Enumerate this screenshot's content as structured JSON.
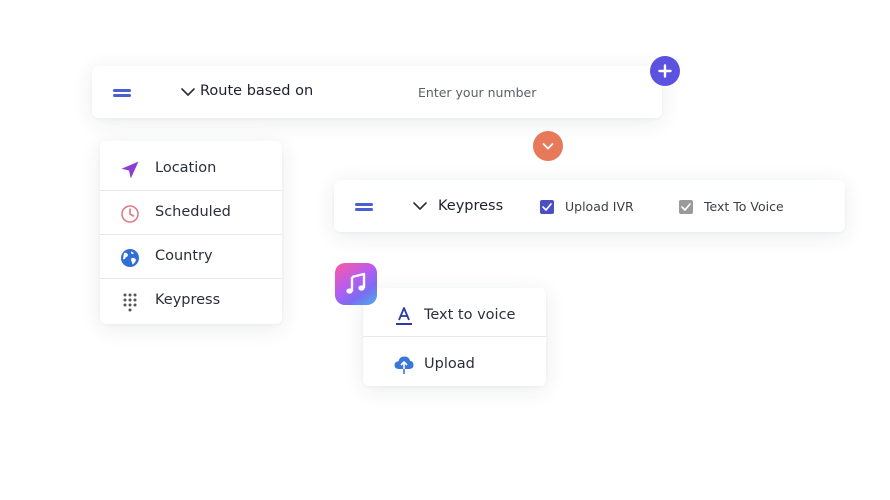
{
  "route_bar": {
    "label": "Route based on",
    "input_placeholder": "Enter your number"
  },
  "route_options": [
    {
      "label": "Location",
      "icon": "location-arrow-icon",
      "color": "#8a3fd1"
    },
    {
      "label": "Scheduled",
      "icon": "clock-icon",
      "color": "#e07a86"
    },
    {
      "label": "Country",
      "icon": "globe-icon",
      "color": "#2f6fd6"
    },
    {
      "label": "Keypress",
      "icon": "dialpad-icon",
      "color": "#555555"
    }
  ],
  "keypress_bar": {
    "label": "Keypress",
    "upload_ivr": {
      "label": "Upload IVR",
      "checked": true,
      "color": "#4a4fc4"
    },
    "text_to_voice": {
      "label": "Text To Voice",
      "checked": true,
      "color": "#9a9a9a"
    }
  },
  "voice_menu": [
    {
      "label": "Text to voice",
      "icon": "text-format-icon",
      "color": "#2a3aa0"
    },
    {
      "label": "Upload",
      "icon": "cloud-upload-icon",
      "color": "#3a78d8"
    }
  ],
  "colors": {
    "add_button": "#5b53e0",
    "expand_button": "#e8785a",
    "hamburger": "#4a5fd0"
  }
}
